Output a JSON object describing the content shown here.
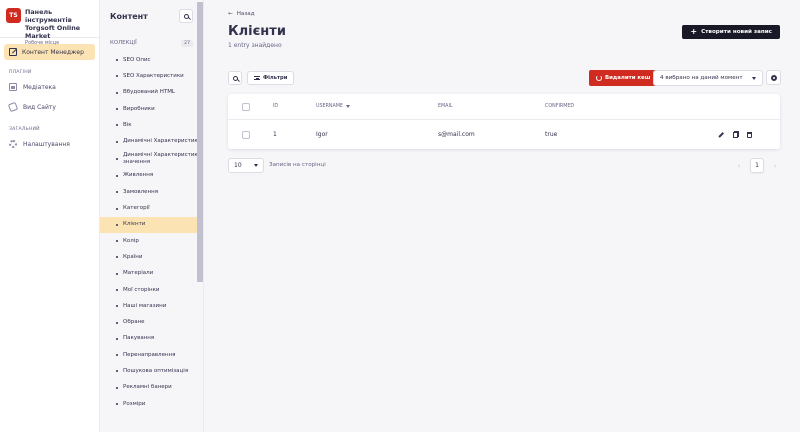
{
  "brand": {
    "title_line1": "Панель інструментів",
    "title_line2": "Torgsoft Online Market",
    "subtitle": "Робоче місце",
    "logo_text": "TS"
  },
  "nav": {
    "active_label": "Контент Менеджер",
    "section_plugins": "ПЛАГІНИ",
    "plugins": [
      {
        "label": "Медіатека",
        "icon": "media-icon"
      },
      {
        "label": "Вид Сайту",
        "icon": "site-icon"
      }
    ],
    "section_general": "ЗАГАЛЬНИЙ",
    "general": [
      {
        "label": "Налаштування",
        "icon": "gear-icon"
      }
    ]
  },
  "content_panel": {
    "title": "Контент",
    "collections_label": "КОЛЕКЦІЇ",
    "collections_count": "27",
    "items": [
      "SEO Опис",
      "SEO Характеристики",
      "Вбудований HTML",
      "Виробники",
      "Вік",
      "Динамічні Характеристики",
      "Динамічні Характеристики значення",
      "Живлення",
      "Замовлення",
      "Категорії",
      "Клієнти",
      "Колір",
      "Країни",
      "Матеріали",
      "Мої сторінки",
      "Наші магазини",
      "Обране",
      "Пакування",
      "Перенаправлення",
      "Пошукова оптимізація",
      "Рекламні банери",
      "Розміри"
    ],
    "active_index": 10
  },
  "main": {
    "back_label": "Назад",
    "title": "Клієнти",
    "subtitle": "1 entry знайдено",
    "create_label": "Створити новий запис",
    "filters_label": "Фільтри",
    "clear_cache_label": "Видалити кеш",
    "visible_select": "4 вибрано на даний момент"
  },
  "table": {
    "headers": {
      "id": "ID",
      "username": "USERNAME",
      "email": "EMAIL",
      "confirmed": "CONFIRMED"
    },
    "rows": [
      {
        "id": "1",
        "username": "Igor",
        "email": "s@mail.com",
        "confirmed": "true"
      }
    ]
  },
  "pagination": {
    "per_page": "10",
    "per_page_label": "Записів на сторінці",
    "current_page": "1",
    "prev": "‹",
    "next": "›"
  },
  "colors": {
    "accent_active": "#fce3b3",
    "danger": "#d02b20",
    "primary_dark": "#181826"
  }
}
